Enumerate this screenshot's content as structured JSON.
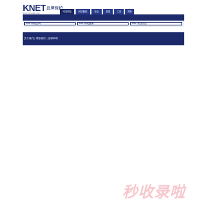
{
  "logo": {
    "knet": "KNET",
    "cn": "品牌保护",
    "sub": "knet.cnmarkip.com"
  },
  "tabs": [
    "可信网站",
    "网站备案",
    "安全",
    "客服",
    "工具",
    "帮助"
  ],
  "search": [
    "KNET网站查询",
    "KNET网站备案",
    "KNET安全认证"
  ],
  "banner": {
    "text": "关于我们 | 联系我们 | 法律声明"
  },
  "watermark": "秒收录啦",
  "colors": {
    "navy": "#1c2a6b",
    "tab": "#2a3d8a"
  }
}
